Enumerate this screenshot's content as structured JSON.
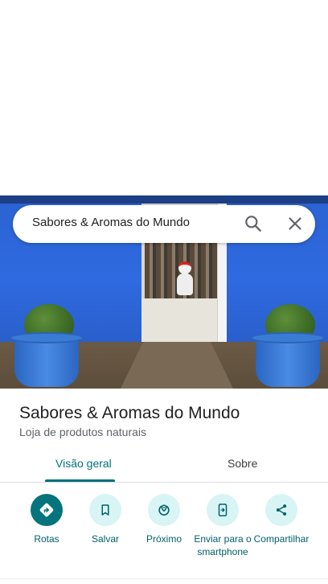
{
  "search": {
    "query": "Sabores & Aromas do Mundo"
  },
  "place": {
    "name": "Sabores & Aromas do Mundo",
    "category": "Loja de produtos naturais"
  },
  "tabs": [
    {
      "label": "Visão geral",
      "selected": true
    },
    {
      "label": "Sobre",
      "selected": false
    }
  ],
  "actions": [
    {
      "label": "Rotas",
      "icon": "directions-icon"
    },
    {
      "label": "Salvar",
      "icon": "bookmark-icon"
    },
    {
      "label": "Próximo",
      "icon": "nearby-icon"
    },
    {
      "label": "Enviar para o smartphone",
      "icon": "send-to-phone-icon"
    },
    {
      "label": "Compartilhar",
      "icon": "share-icon"
    }
  ],
  "colors": {
    "accent": "#00707a",
    "primary_button": "#06747c",
    "secondary_button": "#d8f4f5"
  }
}
